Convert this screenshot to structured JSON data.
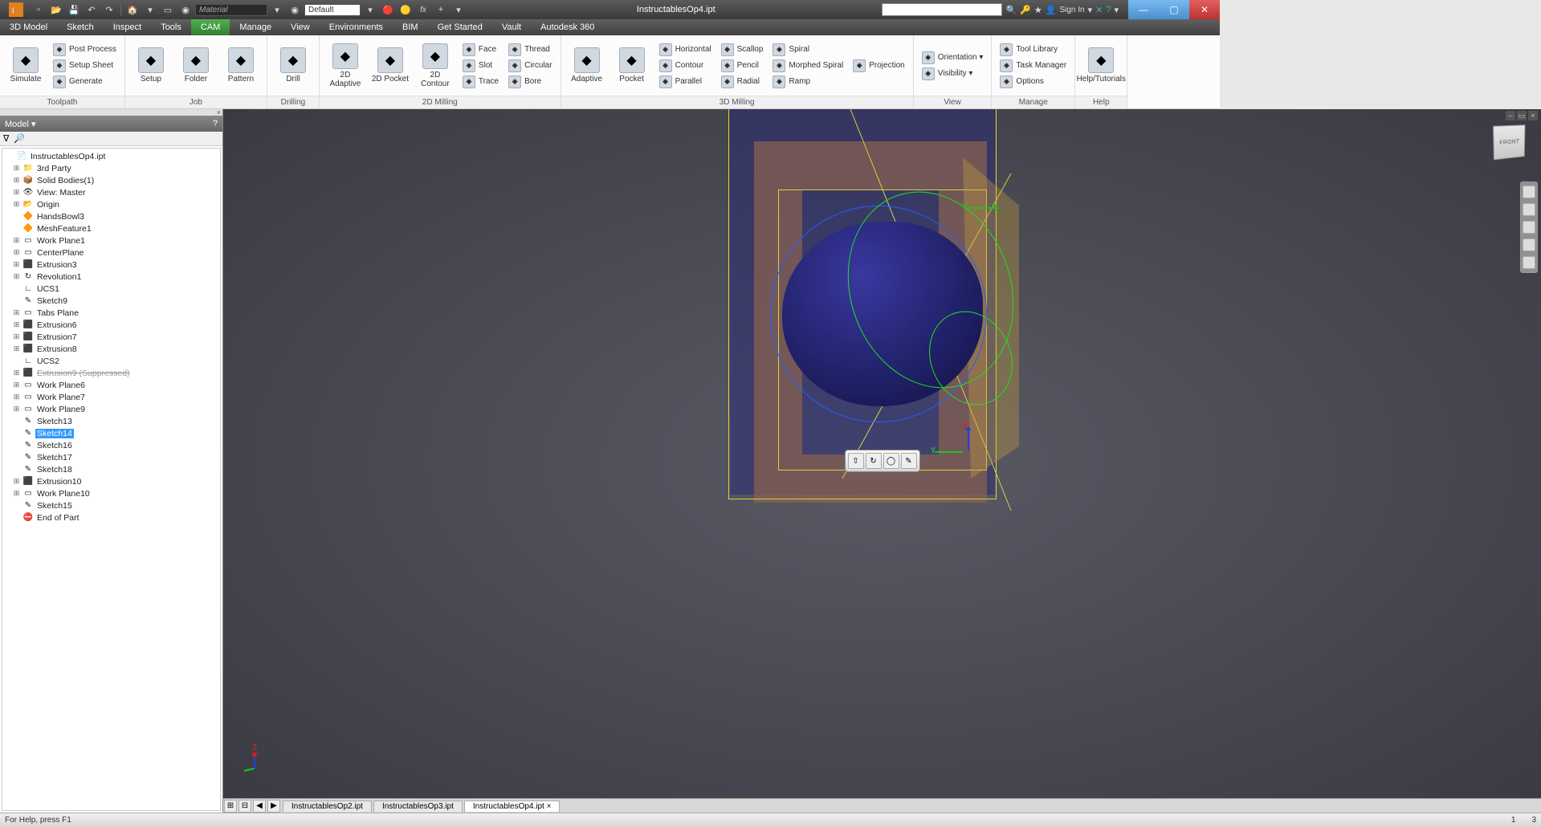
{
  "title_bar": {
    "document_title": "InstructablesOp4.ipt",
    "material_placeholder": "Material",
    "appearance_value": "Default",
    "signin": "Sign In"
  },
  "menu": {
    "tabs": [
      "3D Model",
      "Sketch",
      "Inspect",
      "Tools",
      "CAM",
      "Manage",
      "View",
      "Environments",
      "BIM",
      "Get Started",
      "Vault",
      "Autodesk 360"
    ],
    "active_index": 4
  },
  "ribbon": {
    "groups": [
      {
        "label": "Toolpath",
        "big": [
          {
            "l": "Simulate"
          }
        ],
        "cols": [
          [
            {
              "l": "Post Process"
            },
            {
              "l": "Setup Sheet"
            },
            {
              "l": "Generate"
            }
          ]
        ]
      },
      {
        "label": "Job",
        "big": [
          {
            "l": "Setup"
          },
          {
            "l": "Folder"
          },
          {
            "l": "Pattern"
          }
        ],
        "cols": []
      },
      {
        "label": "Drilling",
        "big": [
          {
            "l": "Drill"
          }
        ],
        "cols": []
      },
      {
        "label": "2D Milling",
        "big": [
          {
            "l": "2D Adaptive"
          },
          {
            "l": "2D Pocket"
          },
          {
            "l": "2D Contour"
          }
        ],
        "cols": [
          [
            {
              "l": "Face"
            },
            {
              "l": "Slot"
            },
            {
              "l": "Trace"
            }
          ],
          [
            {
              "l": "Thread"
            },
            {
              "l": "Circular"
            },
            {
              "l": "Bore"
            }
          ]
        ]
      },
      {
        "label": "3D Milling",
        "big": [
          {
            "l": "Adaptive"
          },
          {
            "l": "Pocket"
          }
        ],
        "cols": [
          [
            {
              "l": "Horizontal"
            },
            {
              "l": "Contour"
            },
            {
              "l": "Parallel"
            }
          ],
          [
            {
              "l": "Scallop"
            },
            {
              "l": "Pencil"
            },
            {
              "l": "Radial"
            }
          ],
          [
            {
              "l": "Spiral"
            },
            {
              "l": "Morphed Spiral"
            },
            {
              "l": "Ramp"
            }
          ],
          [
            {
              "l": "Projection"
            }
          ]
        ]
      },
      {
        "label": "View",
        "big": [],
        "cols": [
          [
            {
              "l": "Orientation ▾"
            },
            {
              "l": "Visibility ▾"
            }
          ]
        ]
      },
      {
        "label": "Manage",
        "big": [],
        "cols": [
          [
            {
              "l": "Tool Library"
            },
            {
              "l": "Task Manager"
            },
            {
              "l": "Options"
            }
          ]
        ]
      },
      {
        "label": "Help",
        "big": [
          {
            "l": "Help/Tutorials"
          }
        ],
        "cols": []
      }
    ]
  },
  "browser": {
    "title": "Model ▾",
    "root": "InstructablesOp4.ipt",
    "nodes": [
      {
        "indent": 0,
        "exp": "",
        "icon": "📄",
        "label": "InstructablesOp4.ipt"
      },
      {
        "indent": 1,
        "exp": "⊞",
        "icon": "📁",
        "label": "3rd Party"
      },
      {
        "indent": 1,
        "exp": "⊞",
        "icon": "📦",
        "label": "Solid Bodies(1)"
      },
      {
        "indent": 1,
        "exp": "⊞",
        "icon": "👁",
        "label": "View: Master"
      },
      {
        "indent": 1,
        "exp": "⊞",
        "icon": "📂",
        "label": "Origin"
      },
      {
        "indent": 1,
        "exp": "",
        "icon": "🔶",
        "label": "HandsBowl3"
      },
      {
        "indent": 1,
        "exp": "",
        "icon": "🔶",
        "label": "MeshFeature1"
      },
      {
        "indent": 1,
        "exp": "⊞",
        "icon": "▭",
        "label": "Work Plane1"
      },
      {
        "indent": 1,
        "exp": "⊞",
        "icon": "▭",
        "label": "CenterPlane"
      },
      {
        "indent": 1,
        "exp": "⊞",
        "icon": "⬛",
        "label": "Extrusion3"
      },
      {
        "indent": 1,
        "exp": "⊞",
        "icon": "↻",
        "label": "Revolution1"
      },
      {
        "indent": 1,
        "exp": "",
        "icon": "∟",
        "label": "UCS1"
      },
      {
        "indent": 1,
        "exp": "",
        "icon": "✎",
        "label": "Sketch9"
      },
      {
        "indent": 1,
        "exp": "⊞",
        "icon": "▭",
        "label": "Tabs Plane"
      },
      {
        "indent": 1,
        "exp": "⊞",
        "icon": "⬛",
        "label": "Extrusion6"
      },
      {
        "indent": 1,
        "exp": "⊞",
        "icon": "⬛",
        "label": "Extrusion7"
      },
      {
        "indent": 1,
        "exp": "⊞",
        "icon": "⬛",
        "label": "Extrusion8"
      },
      {
        "indent": 1,
        "exp": "",
        "icon": "∟",
        "label": "UCS2"
      },
      {
        "indent": 1,
        "exp": "⊞",
        "icon": "⬛",
        "label": "Extrusion9 (Suppressed)",
        "suppressed": true
      },
      {
        "indent": 1,
        "exp": "⊞",
        "icon": "▭",
        "label": "Work Plane6"
      },
      {
        "indent": 1,
        "exp": "⊞",
        "icon": "▭",
        "label": "Work Plane7"
      },
      {
        "indent": 1,
        "exp": "⊞",
        "icon": "▭",
        "label": "Work Plane9"
      },
      {
        "indent": 1,
        "exp": "",
        "icon": "✎",
        "label": "Sketch13"
      },
      {
        "indent": 1,
        "exp": "",
        "icon": "✎",
        "label": "Sketch14",
        "selected": true
      },
      {
        "indent": 1,
        "exp": "",
        "icon": "✎",
        "label": "Sketch16"
      },
      {
        "indent": 1,
        "exp": "",
        "icon": "✎",
        "label": "Sketch17"
      },
      {
        "indent": 1,
        "exp": "",
        "icon": "✎",
        "label": "Sketch18"
      },
      {
        "indent": 1,
        "exp": "⊞",
        "icon": "⬛",
        "label": "Extrusion10"
      },
      {
        "indent": 1,
        "exp": "⊞",
        "icon": "▭",
        "label": "Work Plane10"
      },
      {
        "indent": 1,
        "exp": "",
        "icon": "✎",
        "label": "Sketch15"
      },
      {
        "indent": 1,
        "exp": "",
        "icon": "⛔",
        "label": "End of Part"
      }
    ]
  },
  "doc_tabs": {
    "tabs": [
      "InstructablesOp2.ipt",
      "InstructablesOp3.ipt",
      "InstructablesOp4.ipt"
    ],
    "active_index": 2
  },
  "status": {
    "help": "For Help, press F1",
    "left_num": "1",
    "right_num": "3"
  },
  "viewcube": {
    "face": "FRONT"
  },
  "axes": {
    "x": "X",
    "y": "Y",
    "y2": "Y",
    "z": "Z"
  }
}
